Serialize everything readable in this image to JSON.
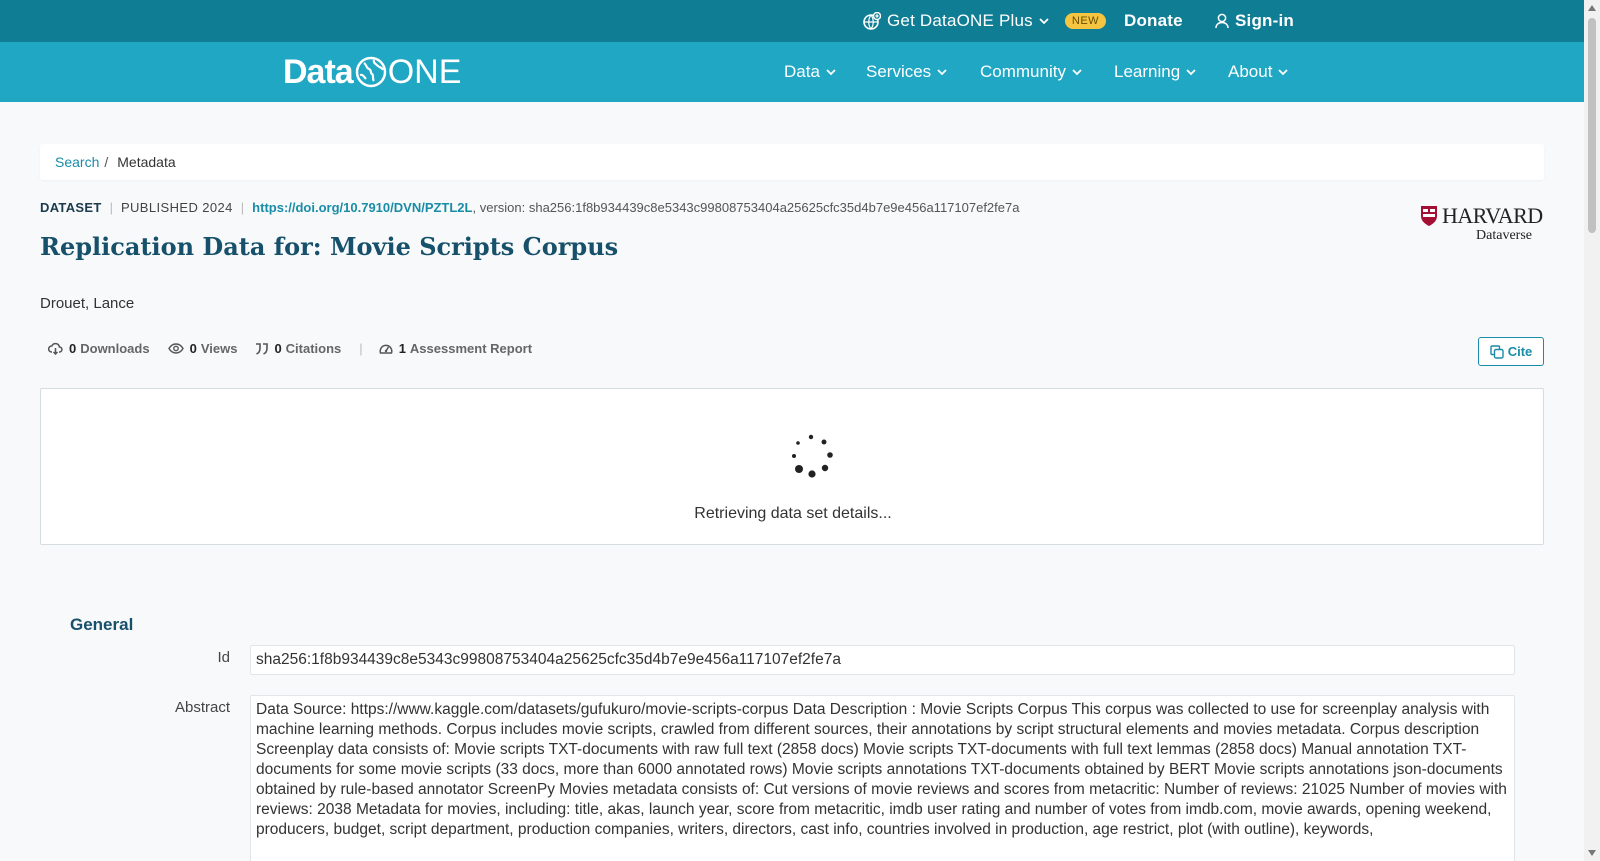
{
  "topbar": {
    "plus_label": "Get DataONE Plus",
    "new_badge": "NEW",
    "donate_label": "Donate",
    "signin_label": "Sign-in"
  },
  "logo": {
    "data": "Data",
    "one": "ONE"
  },
  "nav": {
    "items": [
      {
        "label": "Data"
      },
      {
        "label": "Services"
      },
      {
        "label": "Community"
      },
      {
        "label": "Learning"
      },
      {
        "label": "About"
      }
    ]
  },
  "breadcrumb": {
    "search": "Search",
    "sep": "/",
    "current": "Metadata"
  },
  "dataset": {
    "type": "DATASET",
    "published": "PUBLISHED 2024",
    "doi": "https://doi.org/10.7910/DVN/PZTL2L",
    "version": ", version: sha256:1f8b934439c8e5343c99808753404a25625cfc35d4b7e9e456a117107ef2fe7a",
    "title": "Replication Data for: Movie Scripts Corpus",
    "author": "Drouet, Lance"
  },
  "repository": {
    "name": "HARVARD",
    "sub": "Dataverse"
  },
  "metrics": {
    "downloads_count": "0",
    "downloads_label": "Downloads",
    "views_count": "0",
    "views_label": "Views",
    "citations_count": "0",
    "citations_label": "Citations",
    "assessment_count": "1",
    "assessment_label": "Assessment Report"
  },
  "cite_label": "Cite",
  "loading_text": "Retrieving data set details...",
  "general": {
    "title": "General",
    "id_label": "Id",
    "id_value": "sha256:1f8b934439c8e5343c99808753404a25625cfc35d4b7e9e456a117107ef2fe7a",
    "abstract_label": "Abstract",
    "abstract_value": "Data Source: https://www.kaggle.com/datasets/gufukuro/movie-scripts-corpus Data Description : Movie Scripts Corpus This corpus was collected to use for screenplay analysis with machine learning methods. Corpus includes movie scripts, crawled from different sources, their annotations by script structural elements and movies metadata. Corpus description Screenplay data consists of: Movie scripts TXT-documents with raw full text (2858 docs) Movie scripts TXT-documents with full text lemmas (2858 docs) Manual annotation TXT-documents for some movie scripts (33 docs, more than 6000 annotated rows) Movie scripts annotations TXT-documents obtained by BERT Movie scripts annotations json-documents obtained by rule-based annotator ScreenPy Movies metadata consists of: Cut versions of movie reviews and scores from metacritic: Number of reviews: 21025 Number of movies with reviews: 2038 Metadata for movies, including: title, akas, launch year, score from metacritic, imdb user rating and number of votes from imdb.com, movie awards, opening weekend, producers, budget, script department, production companies, writers, directors, cast info, countries involved in production, age restrict, plot (with outline), keywords,"
  }
}
